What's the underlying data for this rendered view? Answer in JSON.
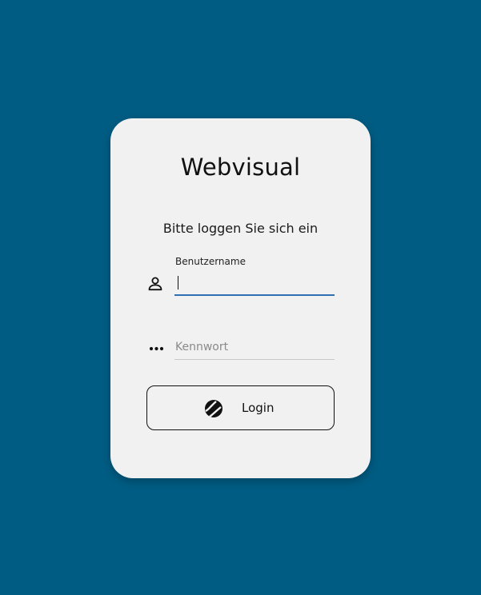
{
  "app": {
    "title": "Webvisual",
    "subtitle": "Bitte loggen Sie sich ein"
  },
  "form": {
    "username": {
      "label": "Benutzername",
      "value": "",
      "icon": "user-icon"
    },
    "password": {
      "placeholder": "Kennwort",
      "value": "",
      "icon": "password-dots-icon"
    },
    "login_button": {
      "label": "Login",
      "icon": "webvisual-logo-icon"
    }
  },
  "colors": {
    "background": "#005c83",
    "card": "#f2f1f2",
    "accent": "#2f6fb3"
  }
}
